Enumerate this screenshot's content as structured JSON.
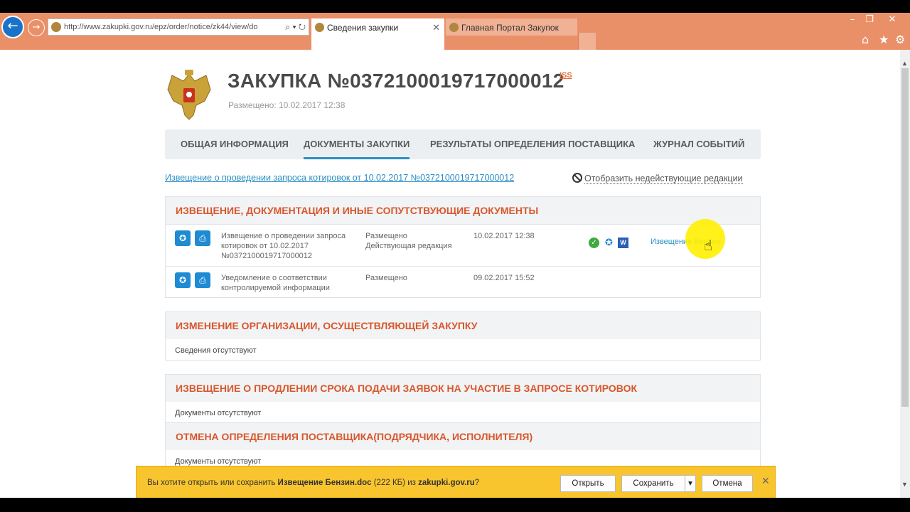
{
  "browser": {
    "url": "http://www.zakupki.gov.ru/epz/order/notice/zk44/view/do",
    "tabs": [
      {
        "label": "Сведения закупки",
        "active": true
      },
      {
        "label": "Главная Портал Закупок",
        "active": false
      }
    ],
    "window_controls": [
      "–",
      "❐",
      "✕"
    ],
    "accent": "#ea9068"
  },
  "page": {
    "title": "ЗАКУПКА №0372100019717000012",
    "iss_label": "ISS",
    "posted": "Размещено: 10.02.2017 12:38",
    "tabs": [
      {
        "label": "ОБЩАЯ ИНФОРМАЦИЯ"
      },
      {
        "label": "ДОКУМЕНТЫ ЗАКУПКИ",
        "selected": true
      },
      {
        "label": "РЕЗУЛЬТАТЫ ОПРЕДЕЛЕНИЯ ПОСТАВЩИКА"
      },
      {
        "label": "ЖУРНАЛ СОБЫТИЙ"
      }
    ],
    "notice_link": "Извещение о проведении запроса котировок от 10.02.2017 №0372100019717000012",
    "show_inactive": "Отобразить недействующие редакции",
    "sections": [
      {
        "title": "ИЗВЕЩЕНИЕ, ДОКУМЕНТАЦИЯ И ИНЫЕ СОПУТСТВУЮЩИЕ ДОКУМЕНТЫ",
        "rows": [
          {
            "name": "Извещение о проведении запроса котировок от 10.02.2017 №0372100019717000012",
            "status": "Размещено",
            "status2": "Действующая редакция",
            "date": "10.02.2017 12:38",
            "file": "Извещение Бензин"
          },
          {
            "name": "Уведомление о соответствии контролируемой информации",
            "status": "Размещено",
            "status2": "",
            "date": "09.02.2017 15:52",
            "file": ""
          }
        ]
      },
      {
        "title": "ИЗМЕНЕНИЕ ОРГАНИЗАЦИИ, ОСУЩЕСТВЛЯЮЩЕЙ ЗАКУПКУ",
        "empty": "Сведения отсутствуют"
      },
      {
        "title": "ИЗВЕЩЕНИЕ О ПРОДЛЕНИИ СРОКА ПОДАЧИ ЗАЯВОК НА УЧАСТИЕ В ЗАПРОСЕ КОТИРОВОК",
        "empty": "Документы отсутствуют"
      },
      {
        "title": "ОТМЕНА ОПРЕДЕЛЕНИЯ ПОСТАВЩИКА(ПОДРЯДЧИКА, ИСПОЛНИТЕЛЯ)",
        "empty": "Документы отсутствуют"
      }
    ],
    "heading_color": "#d9572b",
    "link_color": "#2a8fc4"
  },
  "download_bar": {
    "prefix": "Вы хотите открыть или сохранить ",
    "filename": "Извещение Бензин.doc",
    "size": " (222 КБ) из ",
    "site": "zakupki.gov.ru",
    "suffix": "?",
    "open_label": "Открыть",
    "save_label": "Сохранить",
    "cancel_label": "Отмена",
    "color": "#f9c52e"
  }
}
